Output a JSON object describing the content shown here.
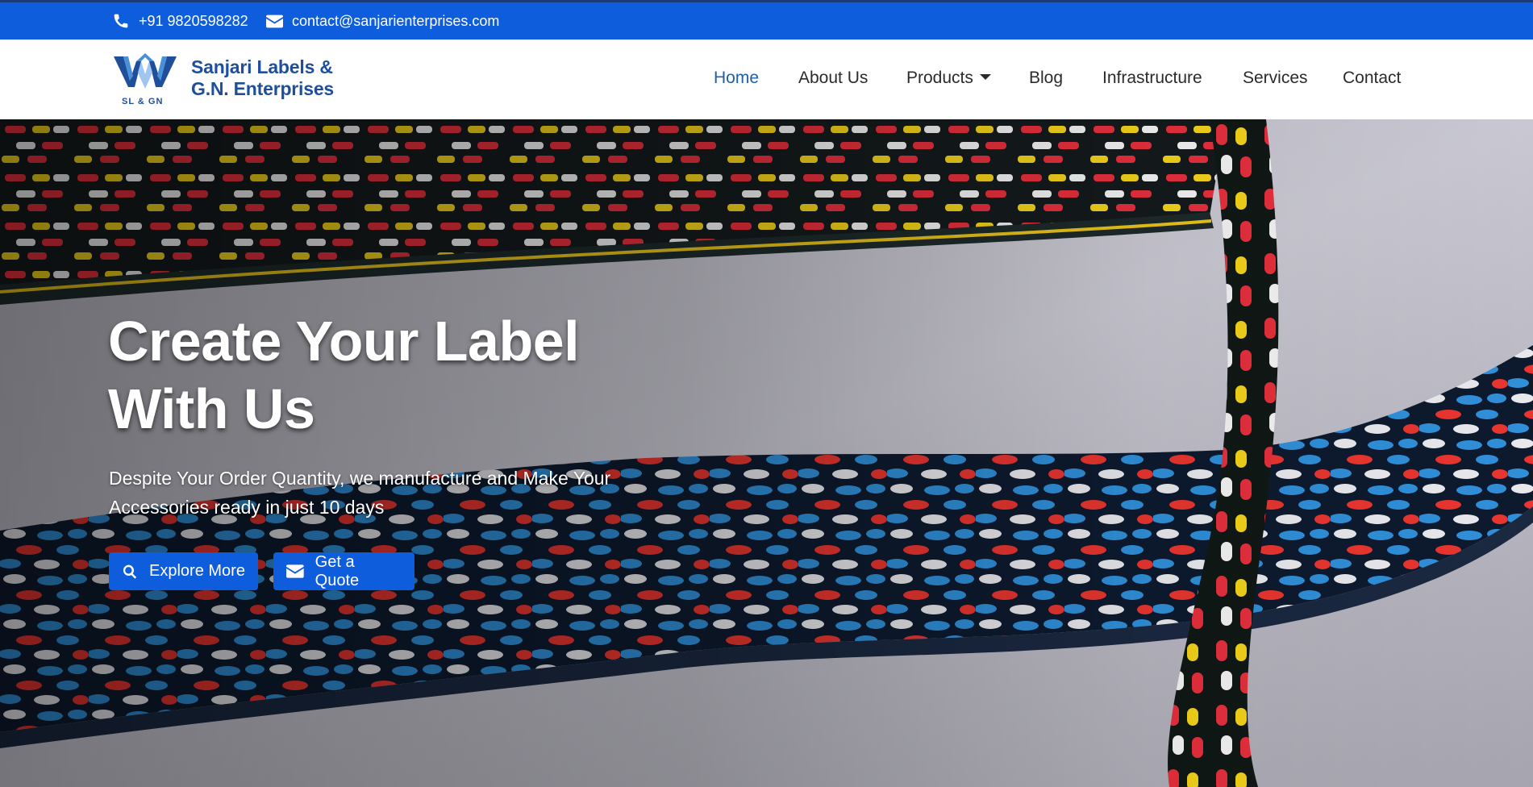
{
  "topbar": {
    "phone": "+91 9820598282",
    "email": "contact@sanjarienterprises.com",
    "phone_icon": "phone-icon",
    "email_icon": "envelope-icon",
    "background": "#0d5ddc"
  },
  "brand": {
    "logo_text": "SL & GN",
    "line1": "Sanjari Labels &",
    "line2": "G.N. Enterprises",
    "color": "#1f4f9a"
  },
  "nav": {
    "items": [
      {
        "label": "Home",
        "active": true
      },
      {
        "label": "About Us"
      },
      {
        "label": "Products",
        "dropdown": true
      },
      {
        "label": "Blog"
      },
      {
        "label": "Infrastructure"
      },
      {
        "label": "Services"
      },
      {
        "label": "Contact"
      }
    ]
  },
  "hero": {
    "title_line1": "Create Your Label",
    "title_line2": "With Us",
    "subtitle": "Despite Your Order Quantity, we manufacture and Make Your Accessories ready in just 10 days",
    "buttons": [
      {
        "label": "Explore More",
        "icon": "search-icon"
      },
      {
        "label": "Get a Quote",
        "icon": "envelope-icon"
      }
    ]
  }
}
